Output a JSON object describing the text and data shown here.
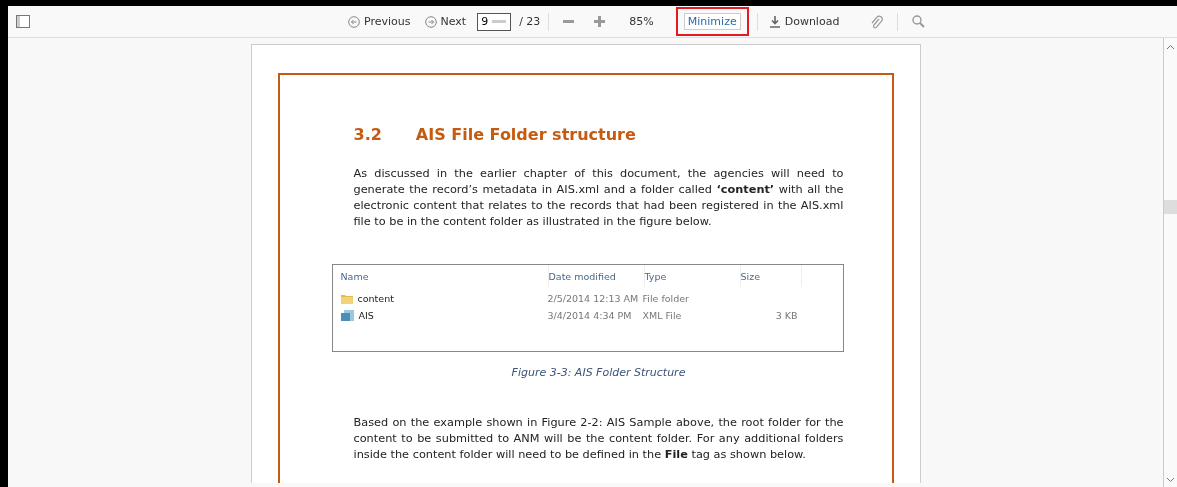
{
  "toolbar": {
    "previous": "Previous",
    "next": "Next",
    "page_value": "9",
    "page_total": "/ 23",
    "zoom": "85%",
    "minimize": "Minimize",
    "minimize_highlighted": true,
    "download": "Download"
  },
  "document": {
    "section_number": "3.2",
    "section_title": "AIS File Folder structure",
    "paragraph_1": "As discussed in the earlier chapter of this document, the agencies will need to generate the record’s metadata in AIS.xml and a folder called **‘content’** with all the electronic content that relates to the records that had been registered in the AIS.xml file to be in the content folder as illustrated in the figure below.",
    "figure": {
      "columns": [
        "Name",
        "Date modified",
        "Type",
        "Size"
      ],
      "rows": [
        {
          "kind": "folder",
          "name": "content",
          "date": "2/5/2014 12:13 AM",
          "type": "File folder",
          "size": ""
        },
        {
          "kind": "xml",
          "name": "AIS",
          "date": "3/4/2014 4:34 PM",
          "type": "XML File",
          "size": "3 KB"
        }
      ],
      "caption": "Figure 3-3: AIS Folder Structure"
    },
    "paragraph_2": "Based on the example shown in Figure 2-2: AIS Sample above, the root folder for the content to be submitted to ANM will be the content folder. For any additional folders inside the content folder will need to be defined in the **File** tag as shown below."
  }
}
